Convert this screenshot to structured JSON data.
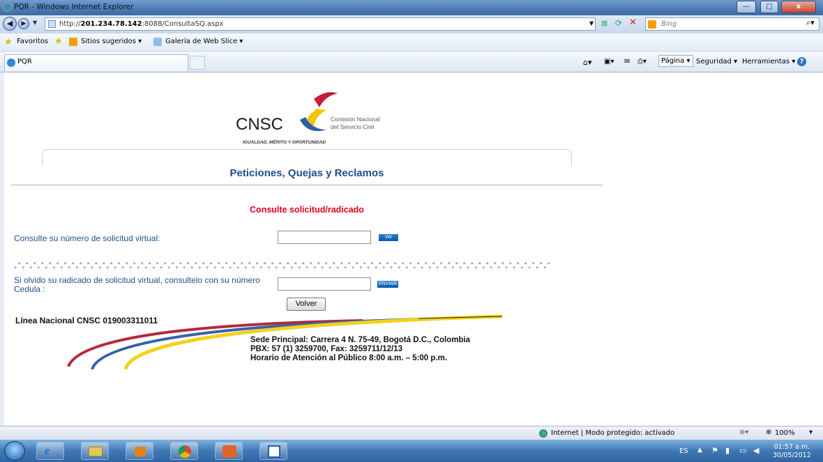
{
  "window": {
    "title": "PQR - Windows Internet Explorer",
    "min": "—",
    "max": "□",
    "close": "x"
  },
  "address": {
    "prefix": "http://",
    "host": "201.234.78.142",
    "path": ":8088/ConsultaSQ.aspx",
    "search_placeholder": "Bing"
  },
  "favorites": {
    "favorites": "Favoritos",
    "suggested": "Sitios sugeridos ▾",
    "webslice": "Galería de Web Slice ▾"
  },
  "tab": {
    "label": "PQR"
  },
  "commandbar": {
    "pagina": "Página ▾",
    "seguridad": "Seguridad ▾",
    "herramientas": "Herramientas ▾",
    "help": "?"
  },
  "logo": {
    "acronym": "CNSC",
    "name_line1": "Comisión Nacional",
    "name_line2": "del Servicio Civil",
    "tagline": "IGUALDAD, MÉRITO Y OPORTUNIDAD",
    "colors": [
      "#c41e3a",
      "#2b5fa8",
      "#f0c400"
    ]
  },
  "page": {
    "title": "Peticiones, Quejas y Reclamos",
    "subtitle": "Consulte solicitud/radicado",
    "q1_label": "Consulte su número de solicitud virtual:",
    "q1_button": "Ver",
    "q2_label_line1": "Si olvido su radicado de solicitud virtual, consultelo con su  número",
    "q2_label_line2": "Cedula :",
    "q2_button": "ENVIAR",
    "dots": "˳°˳°˳°˳°˳°˳°˳°˳°˳°˳°˳°˳°˳°˳°˳°˳°˳°˳°˳°˳°˳°˳°˳°˳°˳°˳°˳°˳°˳°˳°˳°˳°˳°˳°˳°˳°˳°˳°˳°˳°˳°˳°˳°˳°˳°˳°˳°˳°˳°˳°˳°˳°˳°˳°˳°˳°˳°˳°˳°˳°˳°˳°˳°˳°˳°˳°˳°˳°˳°˳°",
    "volver": "Volver",
    "linea": "Línea Nacional CNSC  019003311011",
    "sede": "Sede Principal: Carrera 4 N. 75-49, Bogotá D.C., Colombia",
    "pbx": "PBX: 57 (1) 3259700, Fax: 3259711/12/13",
    "horario": "Horario de Atención  al Público  8:00 a.m. – 5:00 p.m."
  },
  "status": {
    "zone": "Internet | Modo protegido: activado",
    "zoom": "100%"
  },
  "taskbar": {
    "lang": "ES",
    "time": "01:57 a.m.",
    "date": "30/05/2012"
  }
}
